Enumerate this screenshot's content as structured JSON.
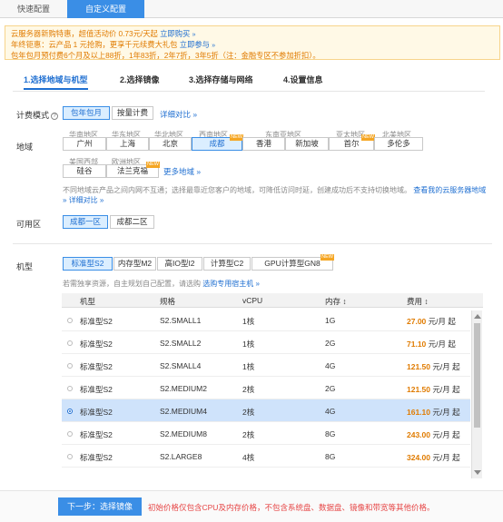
{
  "top_tabs": [
    {
      "label": "快速配置"
    },
    {
      "label": "自定义配置"
    }
  ],
  "notice": {
    "line1_text": "云服务器新购特惠，超值活动价 0.73元/天起",
    "line1_link": "立即购买",
    "line2_text": "年终钜惠：云产品 1 元抢购，更享千元续费大礼包",
    "line2_link": "立即参与",
    "line3_text": "包年包月预付费6个月及以上88折，1年83折，2年7折，3年5折（注：金融专区不参加折扣）。"
  },
  "steps": [
    {
      "label": "1.选择地域与机型"
    },
    {
      "label": "2.选择镜像"
    },
    {
      "label": "3.选择存储与网络"
    },
    {
      "label": "4.设置信息"
    }
  ],
  "billing": {
    "label": "计费模式",
    "options": [
      "包年包月",
      "按量计费"
    ],
    "detail_link": "详细对比"
  },
  "region": {
    "label": "地域",
    "groups": [
      {
        "caption": "华南地区",
        "cities": [
          "广州"
        ]
      },
      {
        "caption": "华东地区",
        "cities": [
          "上海"
        ]
      },
      {
        "caption": "华北地区",
        "cities": [
          "北京"
        ]
      },
      {
        "caption": "西南地区",
        "cities": [
          "成都"
        ]
      },
      {
        "caption": "东南亚地区",
        "cities": [
          "香港",
          "新加坡"
        ]
      },
      {
        "caption": "亚太地区",
        "cities": [
          "首尔"
        ]
      },
      {
        "caption": "北美地区",
        "cities": [
          "多伦多"
        ]
      },
      {
        "caption": "美国西部",
        "cities": [
          "硅谷"
        ]
      },
      {
        "caption": "欧洲地区",
        "cities": [
          "法兰克福"
        ]
      }
    ],
    "new_badge": "NEW",
    "more_link": "更多地域",
    "desc_text": "不同地域云产品之间内网不互通；选择最靠近您客户的地域，可降低访问时延，创建成功后不支持切换地域。",
    "desc_link1": "查看我的云服务器地域",
    "desc_link2": "详细对比"
  },
  "zone": {
    "label": "可用区",
    "options": [
      "成都一区",
      "成都二区"
    ]
  },
  "instance": {
    "label": "机型",
    "types": [
      "标准型S2",
      "内存型M2",
      "高IO型I2",
      "计算型C2",
      "GPU计算型GN8"
    ],
    "hint_text": "若需独享资源，自主规划自己配置，请选购",
    "hint_link": "选购专用宿主机"
  },
  "table": {
    "headers": [
      "机型",
      "规格",
      "vCPU",
      "内存",
      "费用"
    ],
    "rows": [
      {
        "type": "标准型S2",
        "spec": "S2.SMALL1",
        "cpu": "1核",
        "mem": "1G",
        "price": "27.00",
        "unit": "元/月 起"
      },
      {
        "type": "标准型S2",
        "spec": "S2.SMALL2",
        "cpu": "1核",
        "mem": "2G",
        "price": "71.10",
        "unit": "元/月 起"
      },
      {
        "type": "标准型S2",
        "spec": "S2.SMALL4",
        "cpu": "1核",
        "mem": "4G",
        "price": "121.50",
        "unit": "元/月 起"
      },
      {
        "type": "标准型S2",
        "spec": "S2.MEDIUM2",
        "cpu": "2核",
        "mem": "2G",
        "price": "121.50",
        "unit": "元/月 起"
      },
      {
        "type": "标准型S2",
        "spec": "S2.MEDIUM4",
        "cpu": "2核",
        "mem": "4G",
        "price": "161.10",
        "unit": "元/月 起"
      },
      {
        "type": "标准型S2",
        "spec": "S2.MEDIUM8",
        "cpu": "2核",
        "mem": "8G",
        "price": "243.00",
        "unit": "元/月 起"
      },
      {
        "type": "标准型S2",
        "spec": "S2.LARGE8",
        "cpu": "4核",
        "mem": "8G",
        "price": "324.00",
        "unit": "元/月 起"
      }
    ]
  },
  "footer": {
    "next_label": "下一步：选择镜像",
    "note": "初始价格仅包含CPU及内存价格，不包含系统盘、数据盘、镜像和带宽等其他价格。"
  },
  "colors": {
    "accent": "#3a8ee6",
    "price": "#e07b00",
    "warning": "#e64545"
  }
}
